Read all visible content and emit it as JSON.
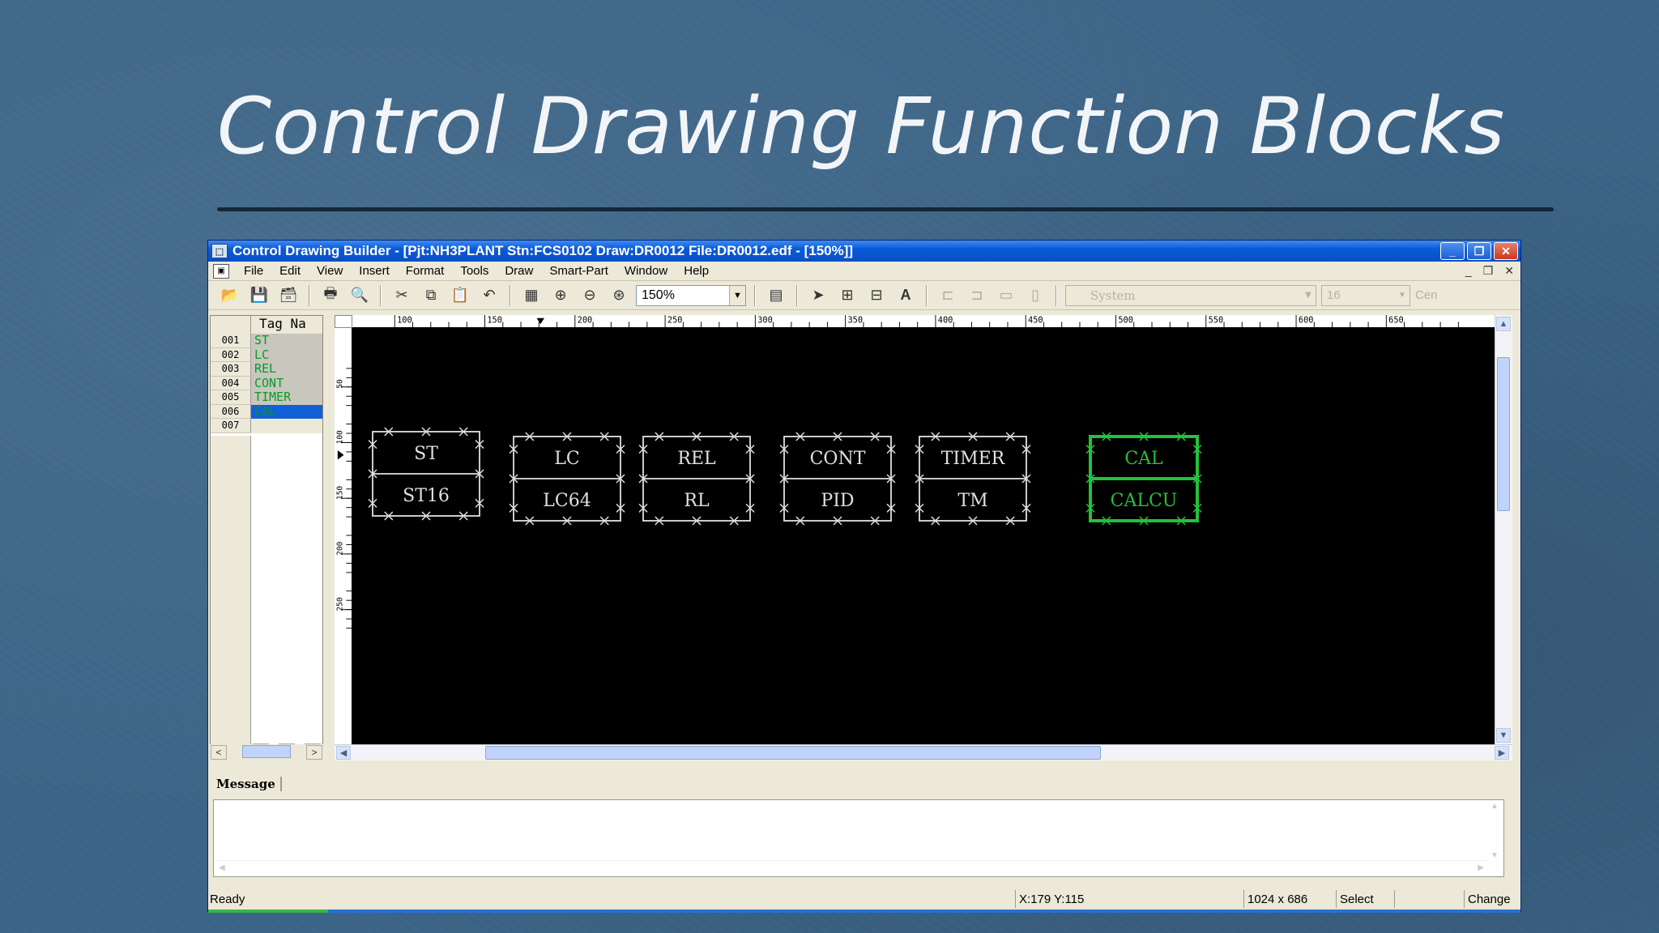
{
  "slide": {
    "title": "Control Drawing Function Blocks"
  },
  "window": {
    "title": "Control Drawing Builder - [Pjt:NH3PLANT Stn:FCS0102 Draw:DR0012 File:DR0012.edf - [150%]]",
    "minimize": "_",
    "maximize": "❐",
    "close": "✕"
  },
  "menu": {
    "items": [
      "File",
      "Edit",
      "View",
      "Insert",
      "Format",
      "Tools",
      "Draw",
      "Smart-Part",
      "Window",
      "Help"
    ],
    "mdi_min": "_",
    "mdi_restore": "❐",
    "mdi_close": "✕"
  },
  "toolbar": {
    "zoom": "150%",
    "font_select": "System",
    "size_select": "16",
    "align_label": "Cen"
  },
  "taglist": {
    "header": "Tag Na",
    "rows": [
      {
        "num": "001",
        "name": "ST"
      },
      {
        "num": "002",
        "name": "LC"
      },
      {
        "num": "003",
        "name": "REL"
      },
      {
        "num": "004",
        "name": "CONT"
      },
      {
        "num": "005",
        "name": "TIMER"
      },
      {
        "num": "006",
        "name": "CAL"
      },
      {
        "num": "007",
        "name": ""
      }
    ],
    "selected_index": 5
  },
  "ruler": {
    "top_labels": [
      "100",
      "150",
      "200",
      "250",
      "300",
      "350",
      "400",
      "450",
      "500",
      "550",
      "600",
      "650"
    ],
    "left_labels": [
      "50",
      "100",
      "150",
      "200",
      "250"
    ]
  },
  "blocks": [
    {
      "top": "ST",
      "bottom": "ST16",
      "selected": false
    },
    {
      "top": "LC",
      "bottom": "LC64",
      "selected": false
    },
    {
      "top": "REL",
      "bottom": "RL",
      "selected": false
    },
    {
      "top": "CONT",
      "bottom": "PID",
      "selected": false
    },
    {
      "top": "TIMER",
      "bottom": "TM",
      "selected": false
    },
    {
      "top": "CAL",
      "bottom": "CALCU",
      "selected": true
    }
  ],
  "colors": {
    "block_normal": "#e0e0e0",
    "block_selected": "#22c23a",
    "canvas": "#000000"
  },
  "message": {
    "tab_label": "Message"
  },
  "status": {
    "ready": "Ready",
    "coords": "X:179  Y:115",
    "size": "1024 x 686",
    "mode": "Select",
    "blank": "",
    "change": "Change"
  }
}
